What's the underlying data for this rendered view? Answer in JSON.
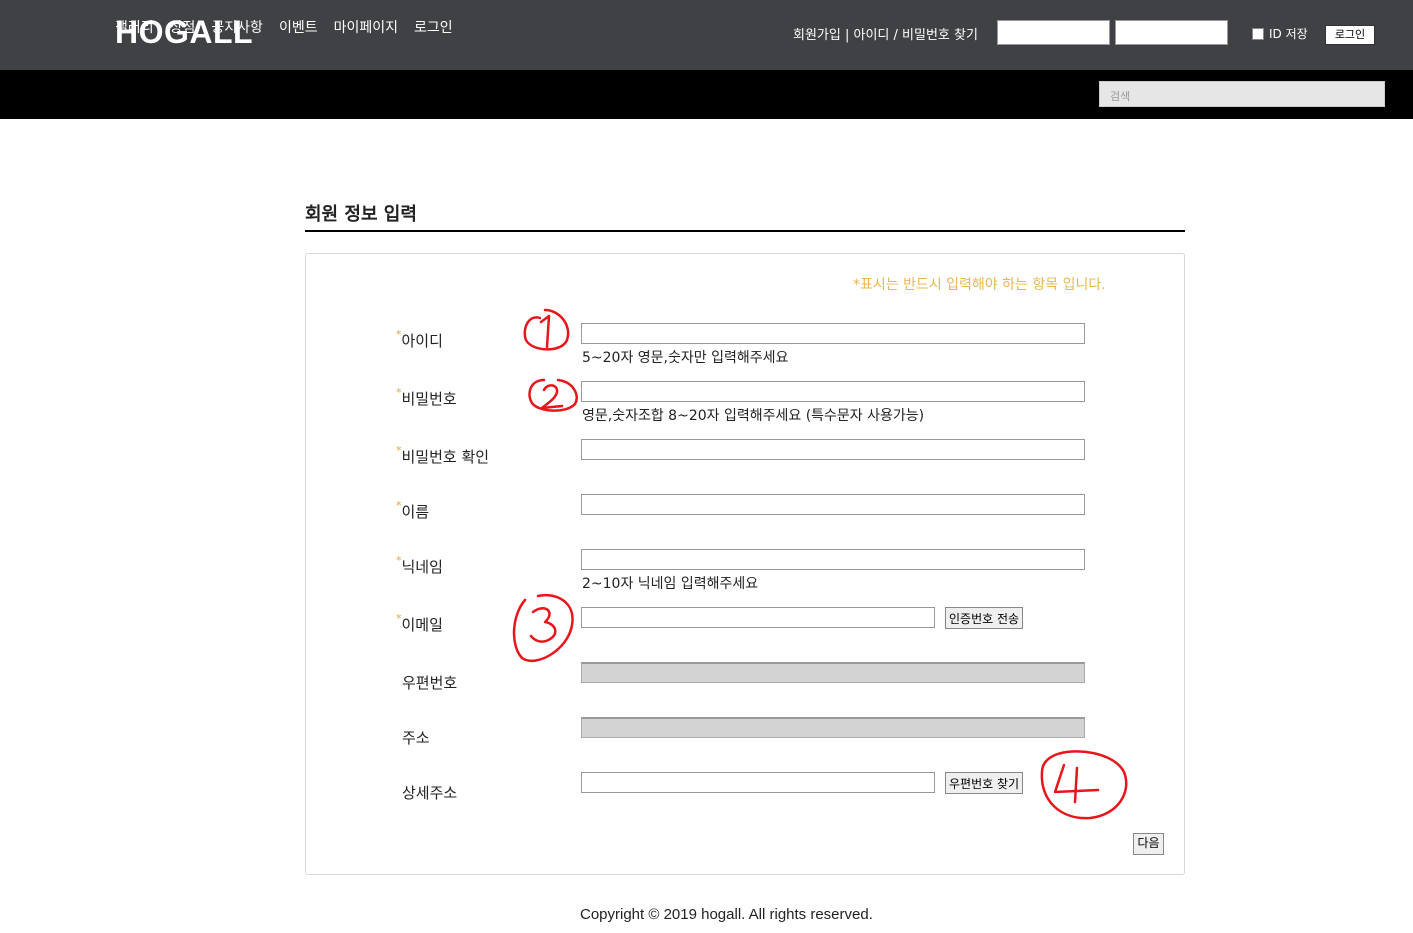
{
  "header": {
    "logo": "HOGALL",
    "signup_link": "회원가입",
    "separator": "|",
    "find_link": "아이디 / 비밀번호 찾기",
    "remember_label": "ID 저장",
    "login_button": "로그인"
  },
  "nav": {
    "items": [
      "갤러리",
      "상점",
      "공지사항",
      "이벤트",
      "마이페이지",
      "로그인"
    ],
    "search_placeholder": "검색"
  },
  "form": {
    "title": "회원 정보 입력",
    "required_notice": "*표시는 반드시 입력해야 하는 항목 입니다.",
    "required_mark": "*",
    "fields": [
      {
        "label": "아이디",
        "required": true,
        "hint": "5~20자 영문,숫자만 입력해주세요"
      },
      {
        "label": "비밀번호",
        "required": true,
        "hint": "영문,숫자조합 8~20자 입력해주세요 (특수문자 사용가능)"
      },
      {
        "label": "비밀번호 확인",
        "required": true,
        "hint": ""
      },
      {
        "label": "이름",
        "required": true,
        "hint": ""
      },
      {
        "label": "닉네임",
        "required": true,
        "hint": "2~10자 닉네임 입력해주세요"
      },
      {
        "label": "이메일",
        "required": true,
        "hint": ""
      },
      {
        "label": "우편번호",
        "required": false,
        "hint": ""
      },
      {
        "label": "주소",
        "required": false,
        "hint": ""
      },
      {
        "label": "상세주소",
        "required": false,
        "hint": ""
      }
    ],
    "send_code_button": "인증번호 전송",
    "find_zip_button": "우편번호 찾기",
    "next_button": "다음"
  },
  "annotations": [
    "1",
    "2",
    "3",
    "4"
  ],
  "annotation_color": "#e8151b",
  "footer": {
    "copyright": "Copyright © 2019 hogall. All rights reserved."
  }
}
